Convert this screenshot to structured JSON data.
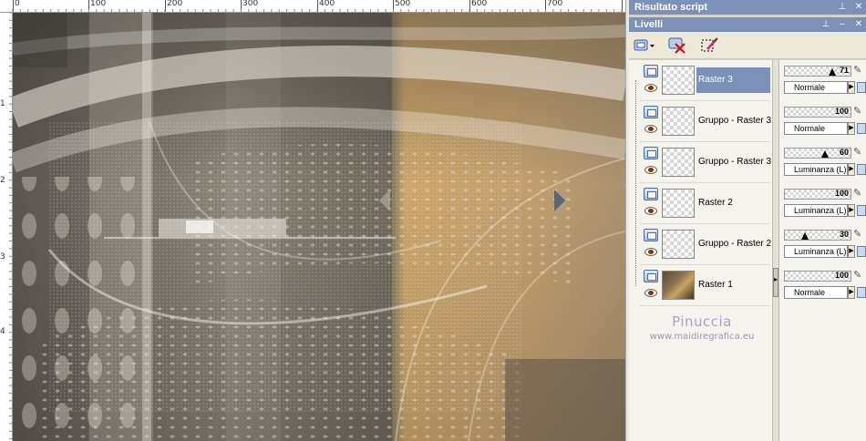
{
  "rulers": {
    "horizontal": [
      "0",
      "100",
      "200",
      "300",
      "400",
      "500",
      "600",
      "700"
    ],
    "vertical": [
      "1",
      "2",
      "3",
      "4"
    ]
  },
  "panels": {
    "script_output_title": "Risultato script",
    "layers_title": "Livelli"
  },
  "toolbar": {
    "icons": [
      "new-layer-icon",
      "delete-layer-icon",
      "edit-selection-icon"
    ]
  },
  "layers": [
    {
      "name": "Raster 3",
      "selected": true,
      "thumb": "transparent",
      "opacity": "71",
      "blend": "Normale"
    },
    {
      "name": "Gruppo - Raster 3",
      "selected": false,
      "thumb": "transparent",
      "opacity": "100",
      "blend": "Normale"
    },
    {
      "name": "Gruppo - Raster 3",
      "selected": false,
      "thumb": "transparent",
      "opacity": "60",
      "blend": "Luminanza (L)"
    },
    {
      "name": "Raster 2",
      "selected": false,
      "thumb": "transparent",
      "opacity": "100",
      "blend": "Luminanza (L)"
    },
    {
      "name": "Gruppo - Raster 2",
      "selected": false,
      "thumb": "transparent",
      "opacity": "30",
      "blend": "Luminanza (L)"
    },
    {
      "name": "Raster 1",
      "selected": false,
      "thumb": "image",
      "opacity": "100",
      "blend": "Normale"
    }
  ],
  "watermark": {
    "name": "Pinuccia",
    "url": "www.maidiregrafica.eu"
  },
  "colors": {
    "title_bar": "#7b91b8",
    "panel_bg": "#ece9d8",
    "selected_layer": "#7b91b8"
  }
}
